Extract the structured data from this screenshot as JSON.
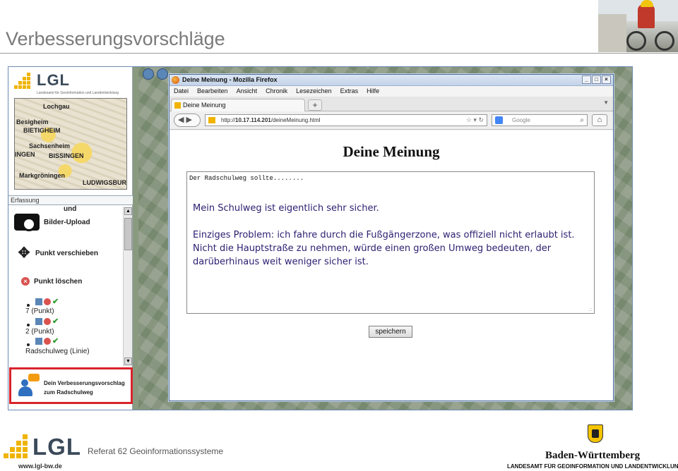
{
  "slide": {
    "title": "Verbesserungsvorschläge",
    "footer_department": "Referat 62 Geoinformationssysteme",
    "footer_url": "www.lgl-bw.de",
    "logo_text": "LGL",
    "bw_name": "Baden-Württemberg",
    "bw_subtitle": "LANDESAMT FÜR GEOINFORMATION UND LANDENTWICKLUN"
  },
  "app_panel": {
    "logo_text": "LGL",
    "logo_subtitle": "Landesamt für Geoinformation und Landentwicklung",
    "map_labels": [
      "Lochgau",
      "Besigheim",
      "BIETIGHEIM",
      "Sachsenheim",
      "BISSINGEN",
      "INGEN",
      "Markgröningen",
      "LUDWIGSBURG"
    ],
    "section_label": "Erfassung",
    "tools": {
      "upload_top": "und",
      "upload_label": "Bilder-Upload",
      "move_label": "Punkt verschieben",
      "delete_label": "Punkt löschen"
    },
    "entries": [
      "7 (Punkt)",
      "2 (Punkt)",
      "Radschulweg (Linie)"
    ],
    "suggestion_line1": "Dein Verbesserungsvorschlag",
    "suggestion_line2": "zum Radschulweg"
  },
  "browser": {
    "window_title": "Deine Meinung - Mozilla Firefox",
    "menu": [
      "Datei",
      "Bearbeiten",
      "Ansicht",
      "Chronik",
      "Lesezeichen",
      "Extras",
      "Hilfe"
    ],
    "tab_title": "Deine Meinung",
    "url_prefix": "http://",
    "url_host": "10.17.114.201",
    "url_path": "/deineMeinung.html",
    "search_placeholder": "Google",
    "page_heading": "Deine Meinung",
    "textarea_prefill": "Der Radschulweg sollte........",
    "message_line1": "Mein Schulweg ist eigentlich sehr sicher.",
    "message_line2": "Einziges Problem: ich fahre durch die Fußgängerzone, was offiziell nicht erlaubt ist. Nicht die Hauptstraße zu nehmen, würde einen großen Umweg bedeuten, der darüberhinaus weit weniger sicher ist.",
    "save_button": "speichern"
  },
  "colors": {
    "highlight_border": "#d9232b",
    "message_text": "#2a1f70",
    "lgl_dots": "#f0b400"
  }
}
